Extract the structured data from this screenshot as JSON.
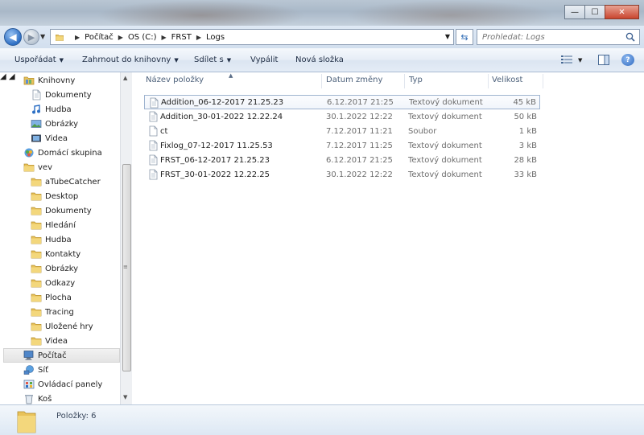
{
  "window": {
    "minimize": "—",
    "maximize": "☐",
    "close": "✕"
  },
  "address": {
    "crumbs": [
      "Počítač",
      "OS (C:)",
      "FRST",
      "Logs"
    ]
  },
  "search": {
    "placeholder": "Prohledat: Logs"
  },
  "toolbar": {
    "organize": "Uspořádat",
    "include_library": "Zahrnout do knihovny",
    "share": "Sdílet s",
    "burn": "Vypálit",
    "new_folder": "Nová složka"
  },
  "nav": {
    "items": [
      {
        "label": "Knihovny"
      },
      {
        "label": "Dokumenty"
      },
      {
        "label": "Hudba"
      },
      {
        "label": "Obrázky"
      },
      {
        "label": "Videa"
      },
      {
        "label": "Domácí skupina"
      },
      {
        "label": "vev"
      },
      {
        "label": "aTubeCatcher"
      },
      {
        "label": "Desktop"
      },
      {
        "label": "Dokumenty"
      },
      {
        "label": "Hledání"
      },
      {
        "label": "Hudba"
      },
      {
        "label": "Kontakty"
      },
      {
        "label": "Obrázky"
      },
      {
        "label": "Odkazy"
      },
      {
        "label": "Plocha"
      },
      {
        "label": "Tracing"
      },
      {
        "label": "Uložené hry"
      },
      {
        "label": "Videa"
      },
      {
        "label": "Počítač"
      },
      {
        "label": "Síť"
      },
      {
        "label": "Ovládací panely"
      },
      {
        "label": "Koš"
      }
    ]
  },
  "columns": {
    "name": "Název položky",
    "date": "Datum změny",
    "type": "Typ",
    "size": "Velikost"
  },
  "files": [
    {
      "name": "Addition_06-12-2017 21.25.23",
      "date": "6.12.2017 21:25",
      "type": "Textový dokument",
      "size": "45 kB"
    },
    {
      "name": "Addition_30-01-2022 12.22.24",
      "date": "30.1.2022 12:22",
      "type": "Textový dokument",
      "size": "50 kB"
    },
    {
      "name": "ct",
      "date": "7.12.2017 11:21",
      "type": "Soubor",
      "size": "1 kB"
    },
    {
      "name": "Fixlog_07-12-2017 11.25.53",
      "date": "7.12.2017 11:25",
      "type": "Textový dokument",
      "size": "3 kB"
    },
    {
      "name": "FRST_06-12-2017 21.25.23",
      "date": "6.12.2017 21:25",
      "type": "Textový dokument",
      "size": "28 kB"
    },
    {
      "name": "FRST_30-01-2022 12.22.25",
      "date": "30.1.2022 12:22",
      "type": "Textový dokument",
      "size": "33 kB"
    }
  ],
  "status": {
    "count": "Položky: 6"
  },
  "icons": {
    "folder": "folder-icon",
    "document": "document-icon",
    "music": "music-icon",
    "picture": "picture-icon",
    "video": "video-icon",
    "homegroup": "homegroup-icon",
    "user": "user-icon",
    "computer": "computer-icon",
    "network": "network-icon",
    "control_panel": "control-panel-icon",
    "recycle_bin": "recycle-bin-icon"
  },
  "colors": {
    "accent": "#2e6fc4",
    "selection_border": "#9fb4d0",
    "folder": "#e8c25a"
  }
}
